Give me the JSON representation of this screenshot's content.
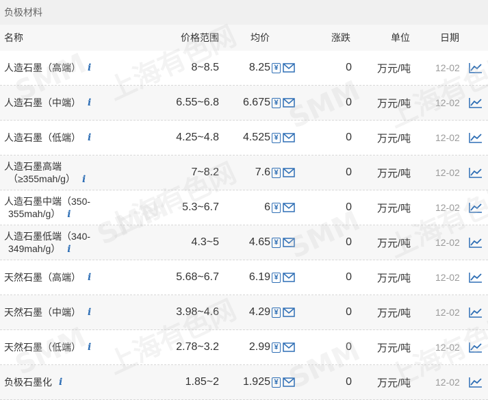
{
  "section_title": "负极材料",
  "columns": {
    "name": "名称",
    "range": "价格范围",
    "avg": "均价",
    "change": "涨跌",
    "unit": "单位",
    "date": "日期"
  },
  "icons": {
    "info": "i",
    "yen": "¥",
    "mail": "mail-icon",
    "chart": "line-chart-icon"
  },
  "colors": {
    "accent": "#2f6fb5",
    "date_gray": "#9a9a9a",
    "stripe": "#f7f7f7"
  },
  "watermark": {
    "logo": "SMM",
    "text": "上海有色网"
  },
  "rows": [
    {
      "name_line1": "人造石墨（高端）",
      "name_line2": "",
      "range": "8~8.5",
      "avg": "8.25",
      "change": "0",
      "unit": "万元/吨",
      "date": "12-02"
    },
    {
      "name_line1": "人造石墨（中端）",
      "name_line2": "",
      "range": "6.55~6.8",
      "avg": "6.675",
      "change": "0",
      "unit": "万元/吨",
      "date": "12-02"
    },
    {
      "name_line1": "人造石墨（低端）",
      "name_line2": "",
      "range": "4.25~4.8",
      "avg": "4.525",
      "change": "0",
      "unit": "万元/吨",
      "date": "12-02"
    },
    {
      "name_line1": "人造石墨高端",
      "name_line2": "（≥355mah/g）",
      "range": "7~8.2",
      "avg": "7.6",
      "change": "0",
      "unit": "万元/吨",
      "date": "12-02"
    },
    {
      "name_line1": "人造石墨中端（350-",
      "name_line2": "355mah/g）",
      "range": "5.3~6.7",
      "avg": "6",
      "change": "0",
      "unit": "万元/吨",
      "date": "12-02"
    },
    {
      "name_line1": "人造石墨低端（340-",
      "name_line2": "349mah/g）",
      "range": "4.3~5",
      "avg": "4.65",
      "change": "0",
      "unit": "万元/吨",
      "date": "12-02"
    },
    {
      "name_line1": "天然石墨（高端）",
      "name_line2": "",
      "range": "5.68~6.7",
      "avg": "6.19",
      "change": "0",
      "unit": "万元/吨",
      "date": "12-02"
    },
    {
      "name_line1": "天然石墨（中端）",
      "name_line2": "",
      "range": "3.98~4.6",
      "avg": "4.29",
      "change": "0",
      "unit": "万元/吨",
      "date": "12-02"
    },
    {
      "name_line1": "天然石墨（低端）",
      "name_line2": "",
      "range": "2.78~3.2",
      "avg": "2.99",
      "change": "0",
      "unit": "万元/吨",
      "date": "12-02"
    },
    {
      "name_line1": "负极石墨化",
      "name_line2": "",
      "range": "1.85~2",
      "avg": "1.925",
      "change": "0",
      "unit": "万元/吨",
      "date": "12-02"
    }
  ]
}
